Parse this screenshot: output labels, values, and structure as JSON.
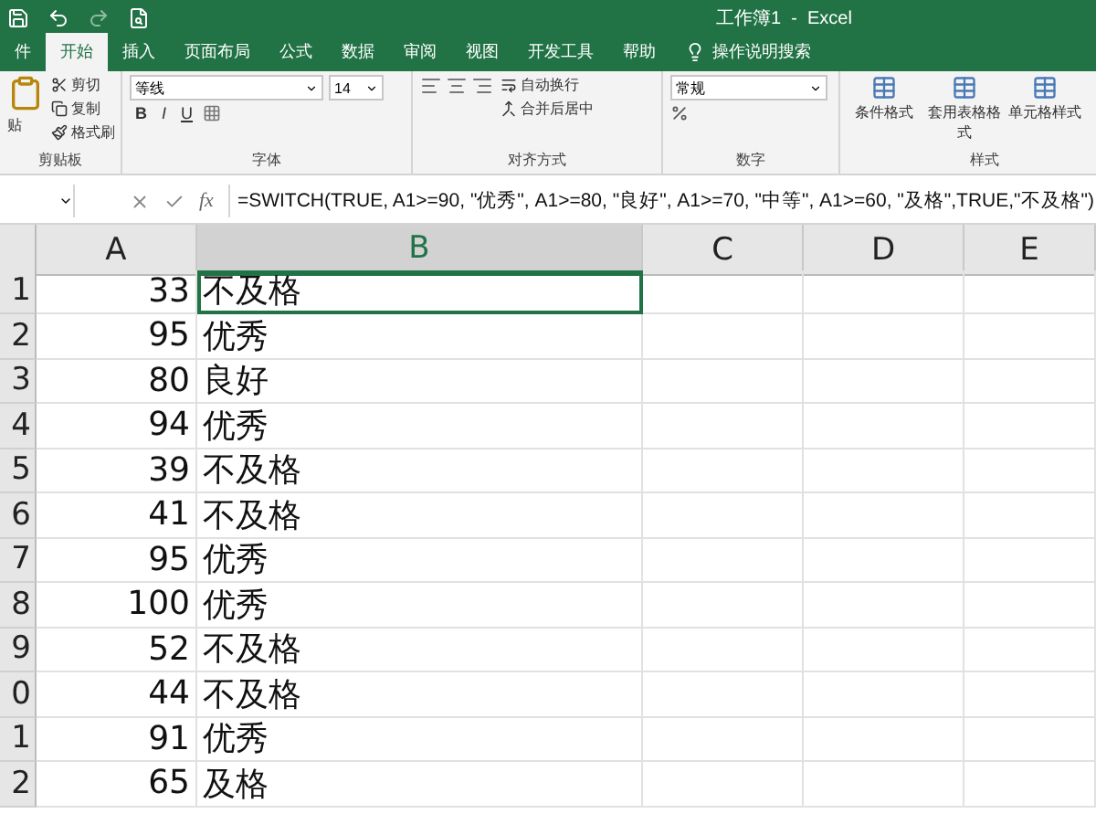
{
  "window": {
    "title": "工作簿1  -  Excel"
  },
  "tabs": [
    {
      "label": "件",
      "selected": false
    },
    {
      "label": "开始",
      "selected": true
    },
    {
      "label": "插入",
      "selected": false
    },
    {
      "label": "页面布局",
      "selected": false
    },
    {
      "label": "公式",
      "selected": false
    },
    {
      "label": "数据",
      "selected": false
    },
    {
      "label": "审阅",
      "selected": false
    },
    {
      "label": "视图",
      "selected": false
    },
    {
      "label": "开发工具",
      "selected": false
    },
    {
      "label": "帮助",
      "selected": false
    }
  ],
  "tell_me": {
    "placeholder": "操作说明搜索"
  },
  "ribbon": {
    "clipboard": {
      "paste": "贴",
      "cut": "剪切",
      "copy": "复制",
      "format_painter": "格式刷",
      "label": "剪贴板"
    },
    "font": {
      "name": "等线",
      "size": "14",
      "bold": "B",
      "italic": "I",
      "underline": "U",
      "label": "字体"
    },
    "alignment": {
      "wrap": "自动换行",
      "merge": "合并后居中",
      "label": "对齐方式"
    },
    "number": {
      "format": "常规",
      "label": "数字"
    },
    "styles": {
      "items": [
        "条件格式",
        "套用表格格式",
        "单元格样式"
      ],
      "label": "样式"
    }
  },
  "formula_bar": {
    "fx": "fx",
    "formula": "=SWITCH(TRUE, A1>=90, \"优秀\", A1>=80, \"良好\", A1>=70, \"中等\", A1>=60, \"及格\",TRUE,\"不及格\")"
  },
  "sheet": {
    "columns": [
      {
        "label": "A",
        "selected": false
      },
      {
        "label": "B",
        "selected": true
      },
      {
        "label": "C",
        "selected": false
      },
      {
        "label": "D",
        "selected": false
      },
      {
        "label": "E",
        "selected": false
      }
    ],
    "rows": [
      {
        "header": "1",
        "a": "33",
        "b": "不及格",
        "selected": true
      },
      {
        "header": "2",
        "a": "95",
        "b": "优秀",
        "selected": false
      },
      {
        "header": "3",
        "a": "80",
        "b": "良好",
        "selected": false
      },
      {
        "header": "4",
        "a": "94",
        "b": "优秀",
        "selected": false
      },
      {
        "header": "5",
        "a": "39",
        "b": "不及格",
        "selected": false
      },
      {
        "header": "6",
        "a": "41",
        "b": "不及格",
        "selected": false
      },
      {
        "header": "7",
        "a": "95",
        "b": "优秀",
        "selected": false
      },
      {
        "header": "8",
        "a": "100",
        "b": "优秀",
        "selected": false
      },
      {
        "header": "9",
        "a": "52",
        "b": "不及格",
        "selected": false
      },
      {
        "header": "0",
        "a": "44",
        "b": "不及格",
        "selected": false
      },
      {
        "header": "1",
        "a": "91",
        "b": "优秀",
        "selected": false
      },
      {
        "header": "2",
        "a": "65",
        "b": "及格",
        "selected": false
      }
    ]
  }
}
